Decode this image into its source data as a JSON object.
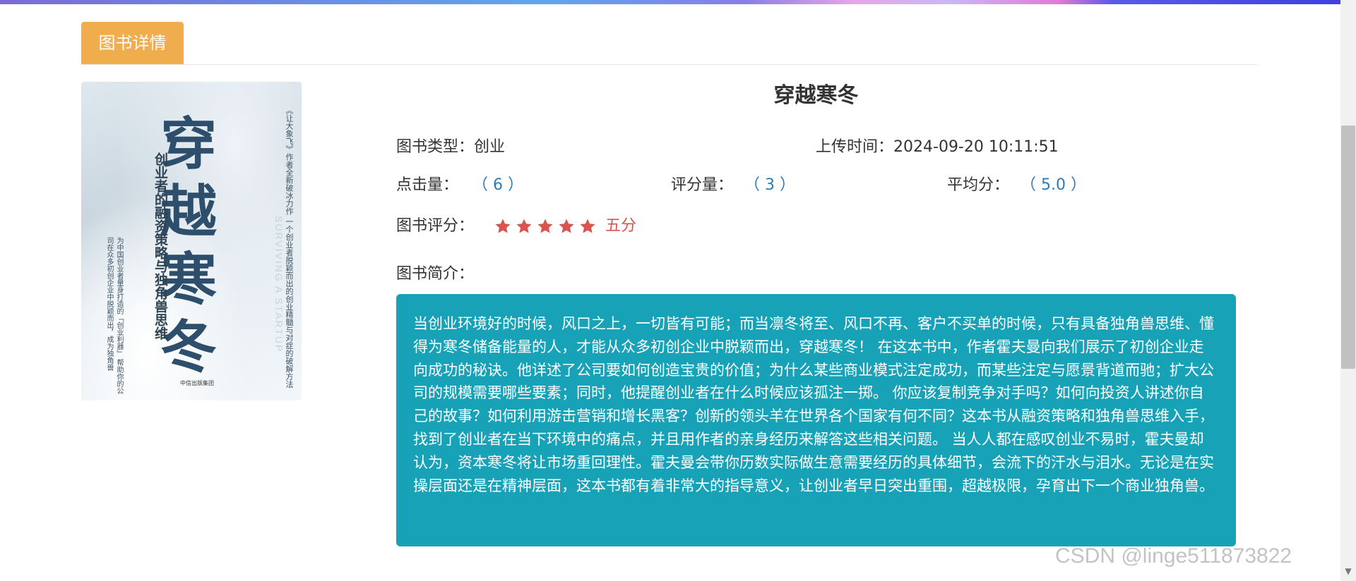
{
  "tab": {
    "label": "图书详情"
  },
  "book": {
    "title": "穿越寒冬",
    "cover": {
      "title_text": "穿越寒冬",
      "subtitle": "创业者的融资策略与独角兽思维",
      "side_text": "《让大象飞》作者全新破冰力作 一个创业者脱颖而出的创业精髓与对症的破解方法",
      "left_text": "为中国创业者量身打造的「创业利器」 帮助你的公司在众多初创企业中脱颖而出，成为独角兽",
      "english": "SURVIVING A STARTUP",
      "publisher": "中信出版集团"
    },
    "type_label": "图书类型：",
    "type_value": "创业",
    "upload_label": "上传时间：",
    "upload_value": "2024-09-20 10:11:51",
    "clicks_label": "点击量：",
    "clicks_value": "（ 6 ）",
    "ratings_label": "评分量：",
    "ratings_value": "（ 3 ）",
    "avg_label": "平均分：",
    "avg_value": "（ 5.0 ）",
    "rating_label": "图书评分：",
    "rating_stars": 5,
    "rating_max": 5,
    "rating_text": "五分",
    "rating_color": "#d9534f",
    "intro_label": "图书简介：",
    "intro_text": "当创业环境好的时候，风口之上，一切皆有可能；而当凛冬将至、风口不再、客户不买单的时候，只有具备独角兽思维、懂得为寒冬储备能量的人，才能从众多初创企业中脱颖而出，穿越寒冬！ 在这本书中，作者霍夫曼向我们展示了初创企业走向成功的秘诀。他详述了公司要如何创造宝贵的价值；为什么某些商业模式注定成功，而某些注定与愿景背道而驰；扩大公司的规模需要哪些要素；同时，他提醒创业者在什么时候应该孤注一掷。 你应该复制竞争对手吗？如何向投资人讲述你自己的故事？如何利用游击营销和增长黑客？创新的领头羊在世界各个国家有何不同？这本书从融资策略和独角兽思维入手，找到了创业者在当下环境中的痛点，并且用作者的亲身经历来解答这些相关问题。 当人人都在感叹创业不易时，霍夫曼却认为，资本寒冬将让市场重回理性。霍夫曼会带你历数实际做生意需要经历的具体细节，会流下的汗水与泪水。无论是在实操层面还是在精神层面，这本书都有着非常大的指导意义，让创业者早日突出重围，超越极限，孕育出下一个商业独角兽。"
  },
  "watermark": "CSDN @linge511873822",
  "colors": {
    "tab": "#f0ad4e",
    "desc_bg": "#17a2b8",
    "value_blue": "#2f7bb5"
  }
}
